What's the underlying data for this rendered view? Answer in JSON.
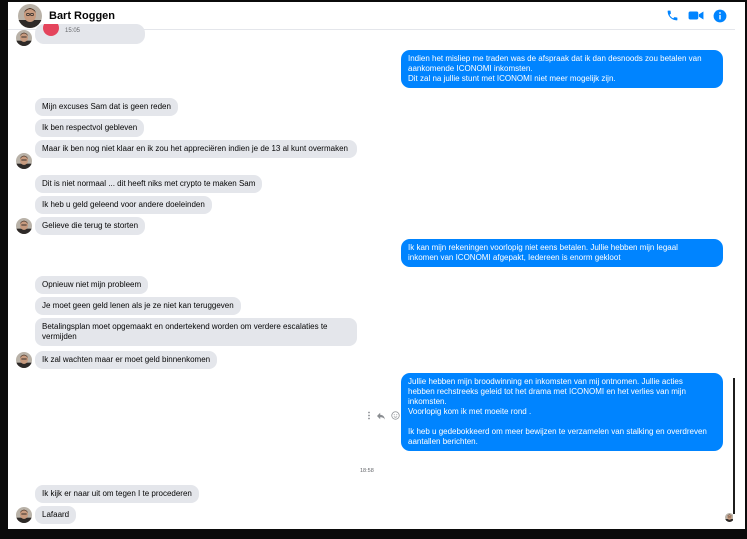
{
  "contact": {
    "name": "Bart Roggen"
  },
  "header_icons": [
    "phone-icon",
    "video-camera-icon",
    "info-icon"
  ],
  "colors": {
    "accent": "#0084ff",
    "incoming_bubble": "#e4e6eb",
    "record": "#e4445c"
  },
  "audio_message": {
    "duration": "15:05"
  },
  "outgoing_1": [
    "Indien het misliep me traden was de afspraak dat ik dan desnoods zou betalen van",
    "aankomende ICONOMI inkomsten.",
    "Dit zal na jullie stunt met ICONOMI niet meer mogelijk zijn."
  ],
  "incoming_1": [
    "Mijn excuses Sam dat is geen reden",
    "Ik ben respectvol gebleven",
    "Maar ik ben nog niet klaar en ik zou het appreciëren indien je de 13 al kunt overmaken",
    "Dit is niet normaal ... dit heeft niks met crypto te maken Sam",
    "Ik heb u geld geleend voor andere doeleinden",
    "Gelieve die terug te storten"
  ],
  "outgoing_2": [
    "Ik kan mijn rekeningen voorlopig niet eens betalen. Jullie hebben mijn legaal",
    "inkomen van ICONOMI afgepakt, Iedereen is enorm gekloot"
  ],
  "incoming_2": [
    "Opnieuw niet mijn probleem",
    "Je moet geen geld lenen als je ze niet kan teruggeven",
    "Betalingsplan moet opgemaakt en ondertekend worden om verdere escalaties te vermijden",
    "Ik zal wachten maar er moet geld binnenkomen"
  ],
  "outgoing_3": [
    "Jullie hebben mijn broodwinning en inkomsten van mij ontnomen. Jullie acties",
    "hebben rechstreeks geleid tot het drama met ICONOMI en het verlies van mijn",
    "inkomsten.",
    "Voorlopig kom ik met moeite rond .",
    "",
    "Ik heb u gedebokkeerd om meer bewijzen te verzamelen van stalking en overdreven",
    "aantallen berichten."
  ],
  "message_actions": [
    "more-options-icon",
    "reply-icon",
    "react-icon"
  ],
  "timestamp": "18:58",
  "incoming_3": [
    "Ik kijk er naar uit om tegen I te procederen",
    "Lafaard"
  ]
}
